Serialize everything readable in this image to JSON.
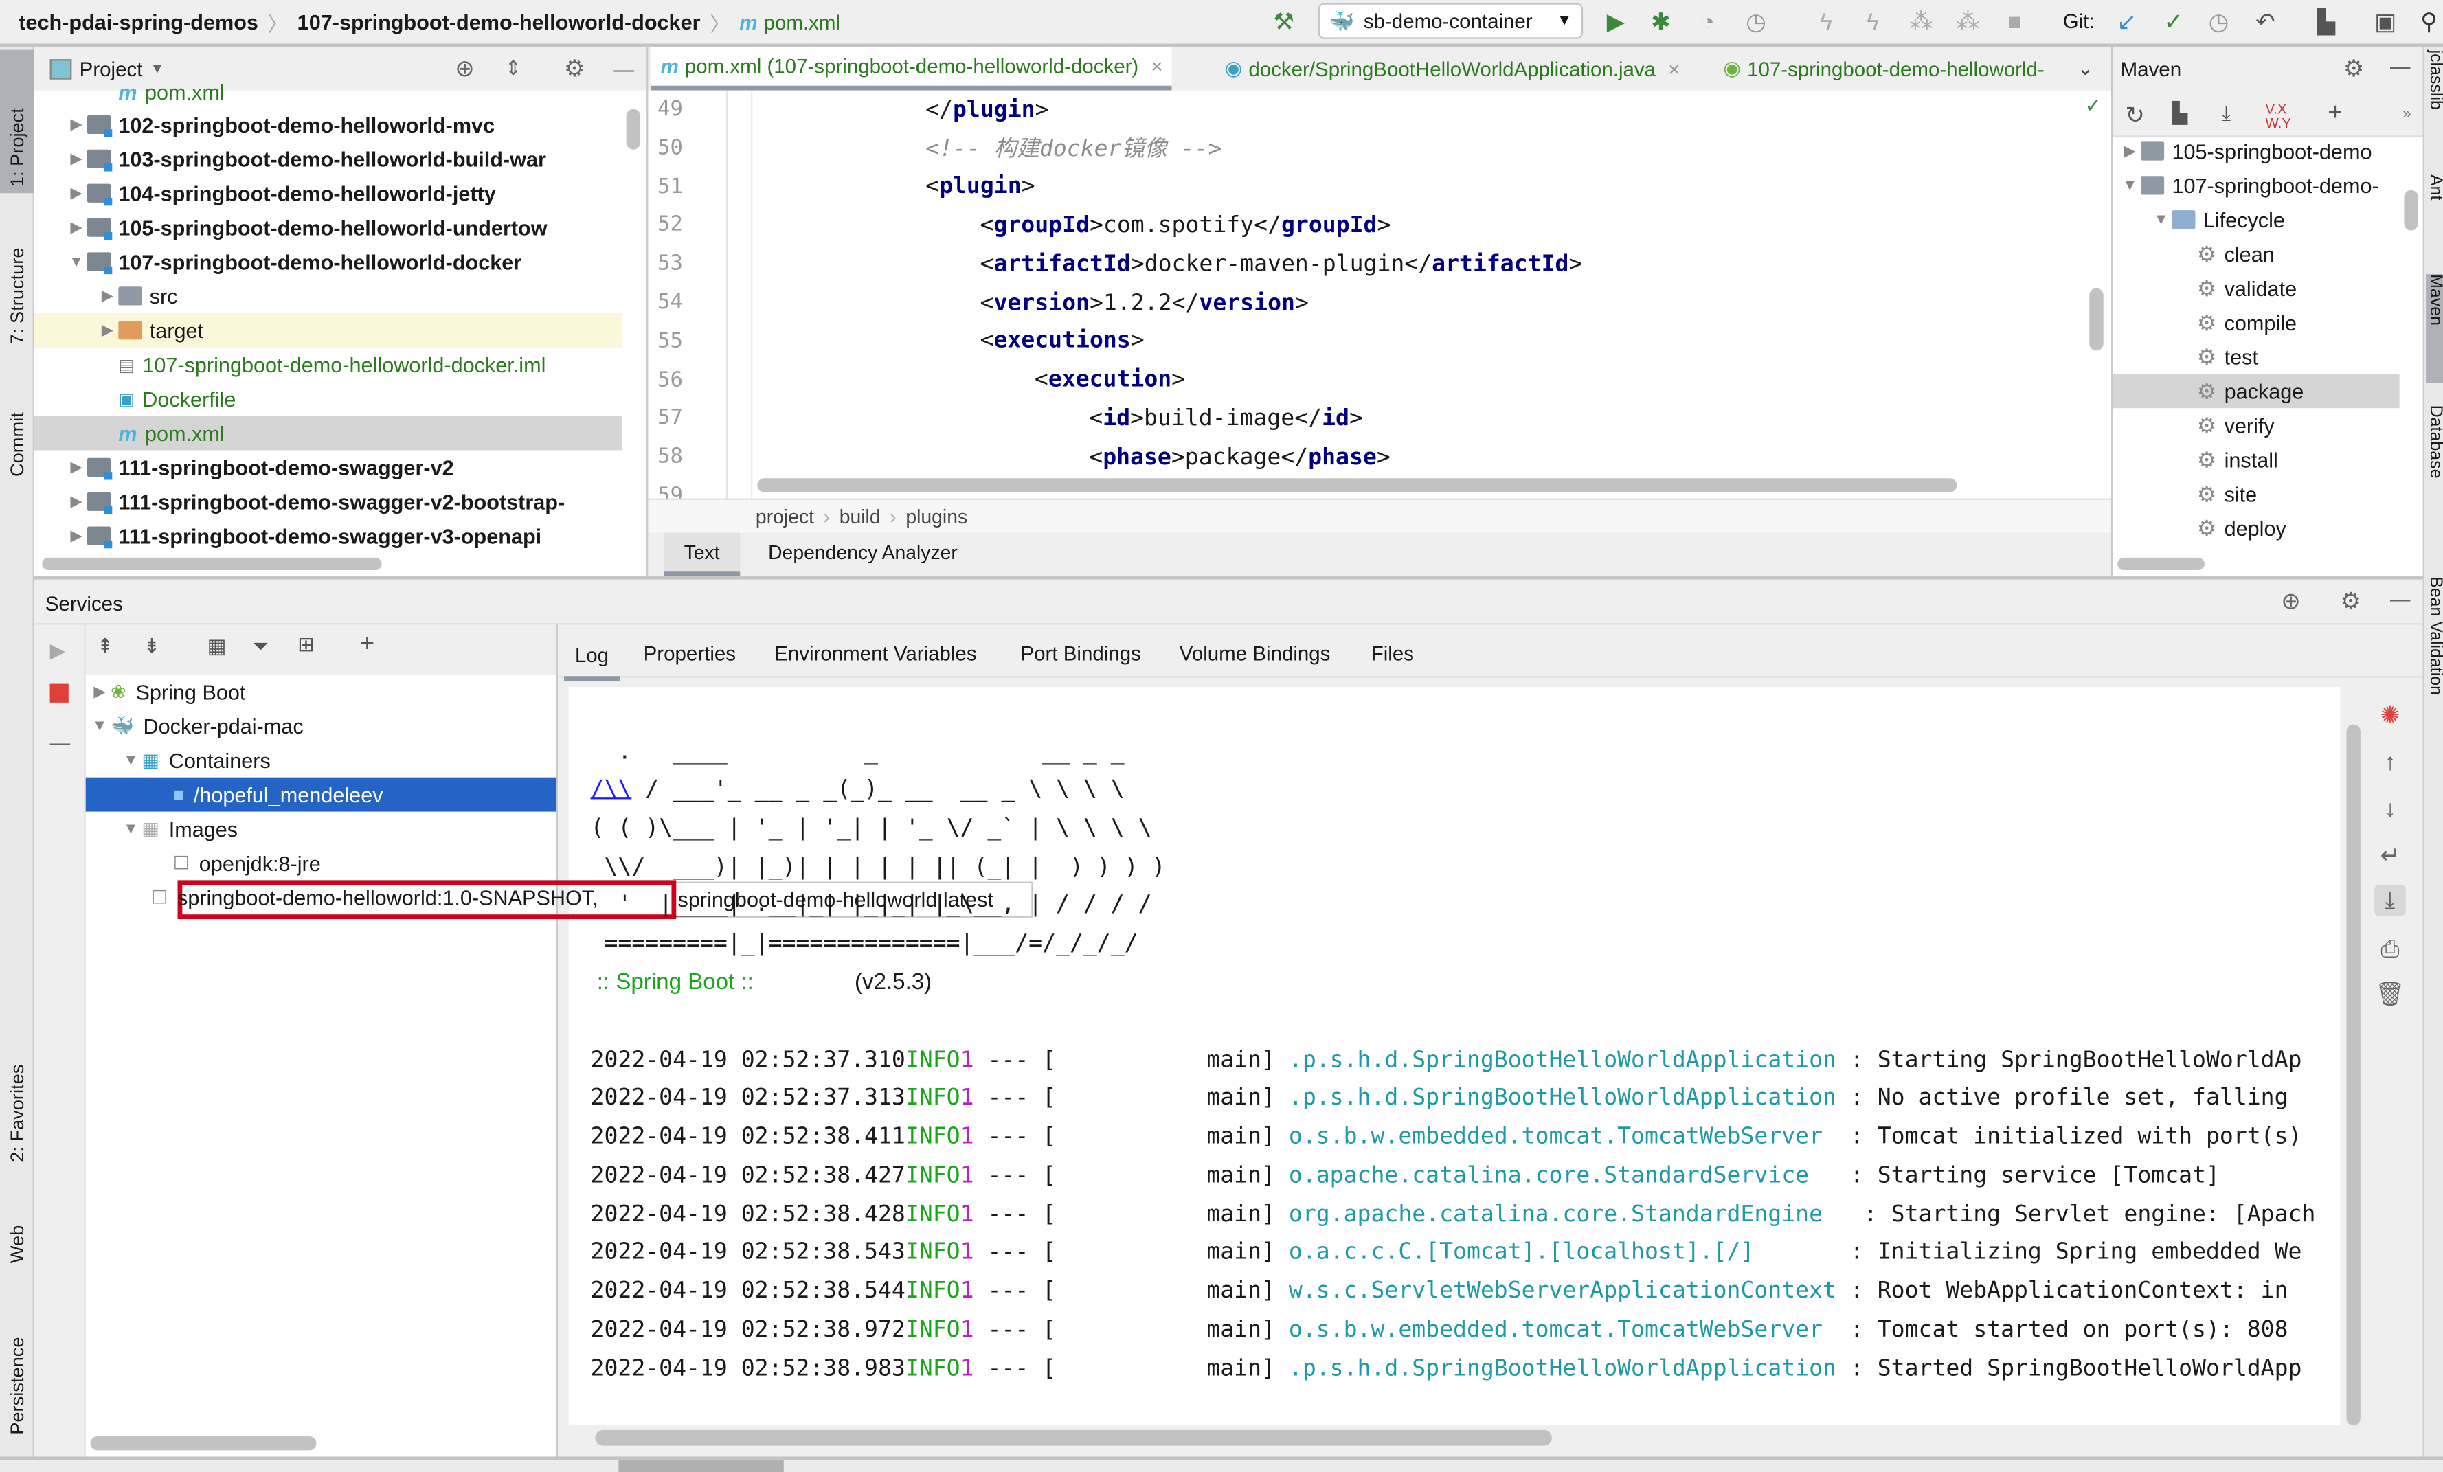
{
  "breadcrumbs": [
    "tech-pdai-spring-demos",
    "107-springboot-demo-helloworld-docker",
    "pom.xml"
  ],
  "toolbar": {
    "run_config": "sb-demo-container",
    "git_label": "Git:"
  },
  "left_strip": [
    "1: Project",
    "7: Structure",
    "Commit",
    "2: Favorites",
    "Web",
    "Persistence"
  ],
  "right_strip": [
    "jclasslib",
    "Ant",
    "Maven",
    "Database",
    "Bean Validation"
  ],
  "project": {
    "title": "Project",
    "items": [
      {
        "label": "pom.xml",
        "type": "maven",
        "level": 2,
        "bold": false
      },
      {
        "label": "102-springboot-demo-helloworld-mvc",
        "type": "module",
        "level": 1,
        "bold": true
      },
      {
        "label": "103-springboot-demo-helloworld-build-war",
        "type": "module",
        "level": 1,
        "bold": true
      },
      {
        "label": "104-springboot-demo-helloworld-jetty",
        "type": "module",
        "level": 1,
        "bold": true
      },
      {
        "label": "105-springboot-demo-helloworld-undertow",
        "type": "module",
        "level": 1,
        "bold": true
      },
      {
        "label": "107-springboot-demo-helloworld-docker",
        "type": "module",
        "level": 1,
        "bold": true,
        "expanded": true
      },
      {
        "label": "src",
        "type": "folder",
        "level": 2
      },
      {
        "label": "target",
        "type": "target",
        "level": 2,
        "highlight": true
      },
      {
        "label": "107-springboot-demo-helloworld-docker.iml",
        "type": "iml",
        "level": 2
      },
      {
        "label": "Dockerfile",
        "type": "docker",
        "level": 2
      },
      {
        "label": "pom.xml",
        "type": "maven",
        "level": 2,
        "selected": true
      },
      {
        "label": "111-springboot-demo-swagger-v2",
        "type": "module",
        "level": 1,
        "bold": true
      },
      {
        "label": "111-springboot-demo-swagger-v2-bootstrap-",
        "type": "module",
        "level": 1,
        "bold": true
      },
      {
        "label": "111-springboot-demo-swagger-v3-openapi",
        "type": "module",
        "level": 1,
        "bold": true
      }
    ]
  },
  "editor": {
    "tabs": [
      "pom.xml (107-springboot-demo-helloworld-docker)",
      "docker/SpringBootHelloWorldApplication.java",
      "107-springboot-demo-helloworld-"
    ],
    "lines": [
      {
        "num": "49",
        "indent": 3,
        "text": "</plugin>"
      },
      {
        "num": "50",
        "indent": 3,
        "text": "<!-- 构建docker镜像 -->",
        "comment": true
      },
      {
        "num": "51",
        "indent": 3,
        "text": "<plugin>"
      },
      {
        "num": "52",
        "indent": 4,
        "text": "<groupId>com.spotify</groupId>"
      },
      {
        "num": "53",
        "indent": 4,
        "text": "<artifactId>docker-maven-plugin</artifactId>"
      },
      {
        "num": "54",
        "indent": 4,
        "text": "<version>1.2.2</version>"
      },
      {
        "num": "55",
        "indent": 4,
        "text": "<executions>"
      },
      {
        "num": "56",
        "indent": 5,
        "text": "<execution>"
      },
      {
        "num": "57",
        "indent": 6,
        "text": "<id>build-image</id>"
      },
      {
        "num": "58",
        "indent": 6,
        "text": "<phase>package</phase>"
      },
      {
        "num": "59",
        "indent": 6,
        "text": ""
      }
    ],
    "path": [
      "project",
      "build",
      "plugins"
    ],
    "bottom_tabs": [
      "Text",
      "Dependency Analyzer"
    ]
  },
  "maven": {
    "title": "Maven",
    "items": [
      {
        "label": "105-springboot-demo",
        "level": 0,
        "icon": "maven"
      },
      {
        "label": "107-springboot-demo-",
        "level": 0,
        "icon": "maven",
        "expanded": true
      },
      {
        "label": "Lifecycle",
        "level": 1,
        "icon": "folder",
        "expanded": true
      },
      {
        "label": "clean",
        "level": 2,
        "icon": "gear"
      },
      {
        "label": "validate",
        "level": 2,
        "icon": "gear"
      },
      {
        "label": "compile",
        "level": 2,
        "icon": "gear"
      },
      {
        "label": "test",
        "level": 2,
        "icon": "gear"
      },
      {
        "label": "package",
        "level": 2,
        "icon": "gear",
        "selected": true
      },
      {
        "label": "verify",
        "level": 2,
        "icon": "gear"
      },
      {
        "label": "install",
        "level": 2,
        "icon": "gear"
      },
      {
        "label": "site",
        "level": 2,
        "icon": "gear"
      },
      {
        "label": "deploy",
        "level": 2,
        "icon": "gear"
      }
    ]
  },
  "services": {
    "title": "Services",
    "tree": [
      {
        "label": "Spring Boot",
        "level": 0,
        "icon": "spring"
      },
      {
        "label": "Docker-pdai-mac",
        "level": 0,
        "icon": "docker",
        "expanded": true
      },
      {
        "label": "Containers",
        "level": 1,
        "icon": "containers",
        "expanded": true
      },
      {
        "label": "/hopeful_mendeleev",
        "level": 2,
        "icon": "container",
        "selected": true
      },
      {
        "label": "Images",
        "level": 1,
        "icon": "images",
        "expanded": true
      },
      {
        "label": "openjdk:8-jre",
        "level": 2,
        "icon": "image"
      },
      {
        "label": "springboot-demo-helloworld:1.0-SNAPSHOT,",
        "level": 2,
        "icon": "image",
        "tooltip": "springboot-demo-helloworld:latest"
      }
    ],
    "tabs": [
      "Log",
      "Properties",
      "Environment Variables",
      "Port Bindings",
      "Volume Bindings",
      "Files"
    ],
    "active_tab": "Log",
    "banner": [
      "  .   ____          _            __ _ _",
      " /\\\\ / ___'_ __ _ _(_)_ __  __ _ \\ \\ \\ \\",
      "( ( )\\___ | '_ | '_| | '_ \\/ _` | \\ \\ \\ \\",
      " \\\\/  ___)| |_)| | | | | || (_| |  ) ) ) )",
      "  '  |____| .__|_| |_|_| |_\\__, | / / / /",
      " =========|_|==============|___/=/_/_/_/"
    ],
    "spring_boot_label": " :: Spring Boot :: ",
    "version": "               (v2.5.3)",
    "log": [
      {
        "time": "2022-04-19 02:52:37.310",
        "level": "INFO",
        "pid": "1",
        "thread": "main",
        "logger": ".p.s.h.d.SpringBootHelloWorldApplication",
        "msg": "Starting SpringBootHelloWorldAp"
      },
      {
        "time": "2022-04-19 02:52:37.313",
        "level": "INFO",
        "pid": "1",
        "thread": "main",
        "logger": ".p.s.h.d.SpringBootHelloWorldApplication",
        "msg": "No active profile set, falling"
      },
      {
        "time": "2022-04-19 02:52:38.411",
        "level": "INFO",
        "pid": "1",
        "thread": "main",
        "logger": "o.s.b.w.embedded.tomcat.TomcatWebServer ",
        "msg": "Tomcat initialized with port(s)"
      },
      {
        "time": "2022-04-19 02:52:38.427",
        "level": "INFO",
        "pid": "1",
        "thread": "main",
        "logger": "o.apache.catalina.core.StandardService  ",
        "msg": "Starting service [Tomcat]"
      },
      {
        "time": "2022-04-19 02:52:38.428",
        "level": "INFO",
        "pid": "1",
        "thread": "main",
        "logger": "org.apache.catalina.core.StandardEngine  ",
        "msg": "Starting Servlet engine: [Apach"
      },
      {
        "time": "2022-04-19 02:52:38.543",
        "level": "INFO",
        "pid": "1",
        "thread": "main",
        "logger": "o.a.c.c.C.[Tomcat].[localhost].[/]      ",
        "msg": "Initializing Spring embedded We"
      },
      {
        "time": "2022-04-19 02:52:38.544",
        "level": "INFO",
        "pid": "1",
        "thread": "main",
        "logger": "w.s.c.ServletWebServerApplicationContext",
        "msg": "Root WebApplicationContext: in"
      },
      {
        "time": "2022-04-19 02:52:38.972",
        "level": "INFO",
        "pid": "1",
        "thread": "main",
        "logger": "o.s.b.w.embedded.tomcat.TomcatWebServer ",
        "msg": "Tomcat started on port(s): 808"
      },
      {
        "time": "2022-04-19 02:52:38.983",
        "level": "INFO",
        "pid": "1",
        "thread": "main",
        "logger": ".p.s.h.d.SpringBootHelloWorldApplication",
        "msg": "Started SpringBootHelloWorldApp"
      }
    ]
  },
  "colors": {
    "selection": "#2364c6",
    "highlight_box": "#d0021b",
    "log_info": "#1aa51a",
    "log_pid": "#c41cc4",
    "log_logger": "#1e9aa6",
    "xml_tag": "#000080"
  }
}
